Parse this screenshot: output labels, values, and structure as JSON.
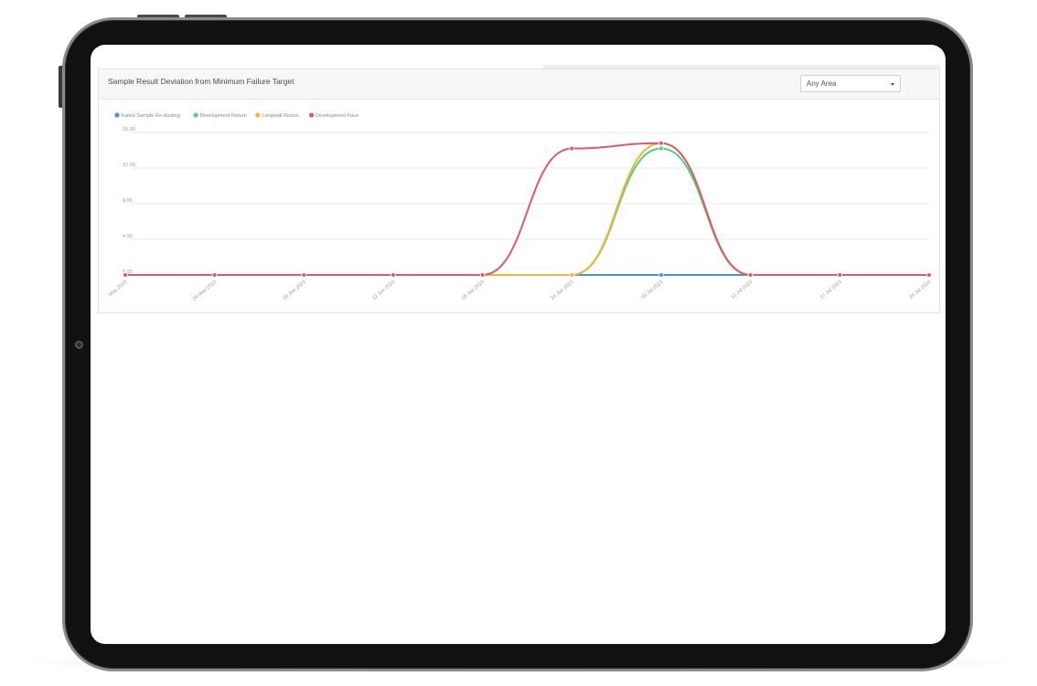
{
  "panel": {
    "title": "Sample Result Deviation from Minimum Failure Target",
    "area_select": {
      "value": "Any Area"
    }
  },
  "colors": {
    "failed_sample": "#4a90e2",
    "development_return": "#4ed08a",
    "longwall_return": "#f2b632",
    "development_face": "#e05a63"
  },
  "icons": {
    "select_caret": "caret-down-icon",
    "legend_marker": "circle-icon"
  },
  "chart_data": {
    "type": "line",
    "x": [
      "May 2023",
      "29 May 2023",
      "05 Jun 2023",
      "12 Jun 2023",
      "19 Jun 2023",
      "26 Jun 2023",
      "03 Jul 2023",
      "10 Jul 2023",
      "17 Jul 2023",
      "24 Jul 2023"
    ],
    "ylim": [
      0,
      16
    ],
    "yticks": [
      "0.00",
      "4.00",
      "8.00",
      "12.00",
      "16.00"
    ],
    "ytick_values": [
      0,
      4,
      8,
      12,
      16
    ],
    "grid": true,
    "legend_position": "top-left",
    "series": [
      {
        "name": "Failed Sample Re-dusting",
        "color": "#4a90e2",
        "values": [
          0,
          0,
          0,
          0,
          0,
          0,
          0,
          0,
          0,
          0
        ]
      },
      {
        "name": "Development Return",
        "color": "#4ed08a",
        "values": [
          0,
          0,
          0,
          0,
          0,
          0,
          14.2,
          0,
          0,
          0
        ]
      },
      {
        "name": "Longwall Return",
        "color": "#f2b632",
        "values": [
          0,
          0,
          0,
          0,
          0,
          0,
          14.8,
          0,
          0,
          0
        ]
      },
      {
        "name": "Development Face",
        "color": "#e05a63",
        "values": [
          0,
          0,
          0,
          0,
          0,
          14.2,
          14.8,
          0,
          0,
          0
        ]
      }
    ]
  }
}
